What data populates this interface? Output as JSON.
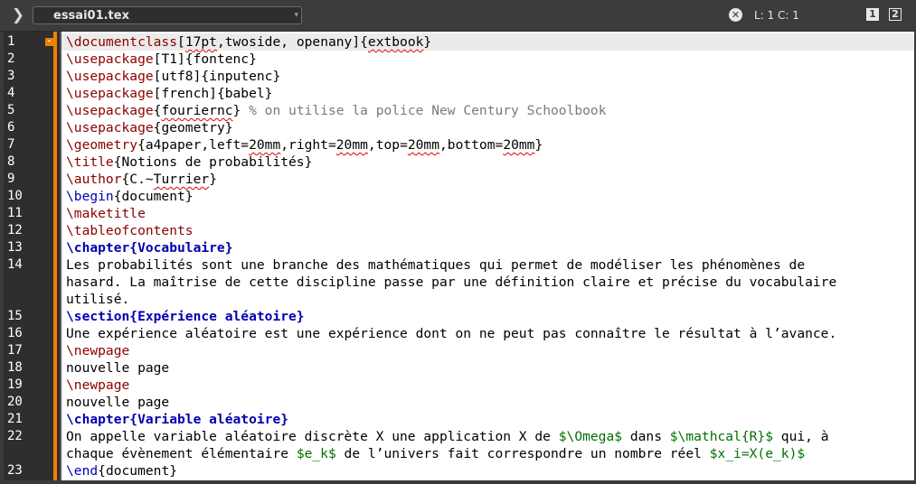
{
  "tabbar": {
    "filename": "essai01.tex",
    "dropdown_icon": "▾",
    "position": "L: 1 C: 1",
    "pane1": "1",
    "pane2": "2"
  },
  "editor": {
    "accent": "#f08000",
    "lines": [
      {
        "n": "1",
        "spans": [
          {
            "t": "\\documentclass",
            "c": "cmd"
          },
          {
            "t": "[",
            "c": ""
          },
          {
            "t": "17pt",
            "c": "err"
          },
          {
            "t": ",twoside, openany]{",
            "c": ""
          },
          {
            "t": "extbook",
            "c": "err"
          },
          {
            "t": "}",
            "c": ""
          }
        ]
      },
      {
        "n": "2",
        "spans": [
          {
            "t": "\\usepackage",
            "c": "cmd"
          },
          {
            "t": "[T1]{fontenc}",
            "c": ""
          }
        ]
      },
      {
        "n": "3",
        "spans": [
          {
            "t": "\\usepackage",
            "c": "cmd"
          },
          {
            "t": "[utf8]{inputenc}",
            "c": ""
          }
        ]
      },
      {
        "n": "4",
        "spans": [
          {
            "t": "\\usepackage",
            "c": "cmd"
          },
          {
            "t": "[french]{babel}",
            "c": ""
          }
        ]
      },
      {
        "n": "5",
        "spans": [
          {
            "t": "\\usepackage",
            "c": "cmd"
          },
          {
            "t": "{",
            "c": ""
          },
          {
            "t": "fouriernc",
            "c": "err"
          },
          {
            "t": "} ",
            "c": ""
          },
          {
            "t": "% on utilise la police New Century Schoolbook",
            "c": "cmt"
          }
        ]
      },
      {
        "n": "6",
        "spans": [
          {
            "t": "\\usepackage",
            "c": "cmd"
          },
          {
            "t": "{geometry}",
            "c": ""
          }
        ]
      },
      {
        "n": "7",
        "spans": [
          {
            "t": "\\geometry",
            "c": "cmd"
          },
          {
            "t": "{a4paper,left=",
            "c": ""
          },
          {
            "t": "20mm",
            "c": "err"
          },
          {
            "t": ",right=",
            "c": ""
          },
          {
            "t": "20mm",
            "c": "err"
          },
          {
            "t": ",top=",
            "c": ""
          },
          {
            "t": "20mm",
            "c": "err"
          },
          {
            "t": ",bottom=",
            "c": ""
          },
          {
            "t": "20mm",
            "c": "err"
          },
          {
            "t": "}",
            "c": ""
          }
        ]
      },
      {
        "n": "8",
        "spans": [
          {
            "t": "\\title",
            "c": "cmd"
          },
          {
            "t": "{Notions de probabilités}",
            "c": ""
          }
        ]
      },
      {
        "n": "9",
        "spans": [
          {
            "t": "\\author",
            "c": "cmd"
          },
          {
            "t": "{C.~",
            "c": ""
          },
          {
            "t": "Turrier",
            "c": "err"
          },
          {
            "t": "}",
            "c": ""
          }
        ]
      },
      {
        "n": "10",
        "spans": [
          {
            "t": "\\begin",
            "c": "kw"
          },
          {
            "t": "{document}",
            "c": ""
          }
        ]
      },
      {
        "n": "11",
        "spans": [
          {
            "t": "\\maketitle",
            "c": "cmd"
          }
        ]
      },
      {
        "n": "12",
        "spans": [
          {
            "t": "\\tableofcontents",
            "c": "cmd"
          }
        ]
      },
      {
        "n": "13",
        "spans": [
          {
            "t": "\\chapter{Vocabulaire}",
            "c": "sec"
          }
        ]
      },
      {
        "n": "14",
        "spans": [
          {
            "t": "Les probabilités sont une branche des mathématiques qui permet de modéliser les phénomènes de",
            "c": ""
          }
        ]
      },
      {
        "n": "",
        "spans": [
          {
            "t": "hasard. La maîtrise de cette discipline passe par une définition claire et précise du vocabulaire",
            "c": ""
          }
        ]
      },
      {
        "n": "",
        "spans": [
          {
            "t": "utilisé.",
            "c": ""
          }
        ]
      },
      {
        "n": "15",
        "spans": [
          {
            "t": "\\section{Expérience aléatoire}",
            "c": "sec"
          }
        ]
      },
      {
        "n": "16",
        "spans": [
          {
            "t": "Une expérience aléatoire est une expérience dont on ne peut pas connaître le résultat à l’avance.",
            "c": ""
          }
        ]
      },
      {
        "n": "17",
        "spans": [
          {
            "t": "\\newpage",
            "c": "cmd"
          }
        ]
      },
      {
        "n": "18",
        "spans": [
          {
            "t": "nouvelle page",
            "c": ""
          }
        ]
      },
      {
        "n": "19",
        "spans": [
          {
            "t": "\\newpage",
            "c": "cmd"
          }
        ]
      },
      {
        "n": "20",
        "spans": [
          {
            "t": "nouvelle page",
            "c": ""
          }
        ]
      },
      {
        "n": "21",
        "spans": [
          {
            "t": "\\chapter{Variable aléatoire}",
            "c": "sec"
          }
        ]
      },
      {
        "n": "22",
        "spans": [
          {
            "t": "On appelle variable aléatoire discrète X une application X de ",
            "c": ""
          },
          {
            "t": "$\\Omega$",
            "c": "math"
          },
          {
            "t": " dans ",
            "c": ""
          },
          {
            "t": "$\\mathcal{R}$",
            "c": "math"
          },
          {
            "t": " qui, à",
            "c": ""
          }
        ]
      },
      {
        "n": "",
        "spans": [
          {
            "t": "chaque évènement élémentaire ",
            "c": ""
          },
          {
            "t": "$e_k$",
            "c": "math"
          },
          {
            "t": " de l’univers fait correspondre un nombre réel ",
            "c": ""
          },
          {
            "t": "$x_i=X(e_k)$",
            "c": "math"
          }
        ]
      },
      {
        "n": "23",
        "spans": [
          {
            "t": "\\end",
            "c": "kw"
          },
          {
            "t": "{document}",
            "c": ""
          }
        ]
      }
    ]
  }
}
